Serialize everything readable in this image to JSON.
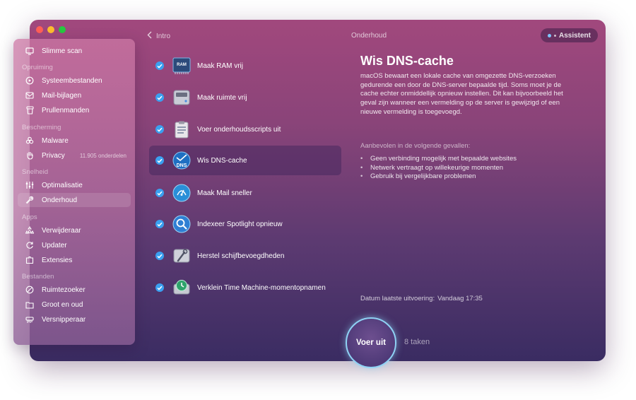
{
  "topbar": {
    "back_label": "Intro",
    "title": "Onderhoud",
    "assistant_label": "Assistent"
  },
  "sidebar": {
    "items": [
      {
        "label": "Slimme scan",
        "icon": "monitor-icon"
      },
      {
        "section": "Opruiming"
      },
      {
        "label": "Systeembestanden",
        "icon": "disc-icon"
      },
      {
        "label": "Mail-bijlagen",
        "icon": "envelope-icon"
      },
      {
        "label": "Prullenmanden",
        "icon": "trash-icon"
      },
      {
        "section": "Bescherming"
      },
      {
        "label": "Malware",
        "icon": "biohazard-icon"
      },
      {
        "label": "Privacy",
        "icon": "hand-icon",
        "extra": "11.905 onderdelen"
      },
      {
        "section": "Snelheid"
      },
      {
        "label": "Optimalisatie",
        "icon": "sliders-icon"
      },
      {
        "label": "Onderhoud",
        "icon": "wrench-icon",
        "active": true
      },
      {
        "section": "Apps"
      },
      {
        "label": "Verwijderaar",
        "icon": "apps-icon"
      },
      {
        "label": "Updater",
        "icon": "refresh-icon"
      },
      {
        "label": "Extensies",
        "icon": "extension-icon"
      },
      {
        "section": "Bestanden"
      },
      {
        "label": "Ruimtezoeker",
        "icon": "pie-icon"
      },
      {
        "label": "Groot en oud",
        "icon": "folder-icon"
      },
      {
        "label": "Versnipperaar",
        "icon": "shredder-icon"
      }
    ]
  },
  "tasks": [
    {
      "label": "Maak RAM vrij",
      "icon": "ram-icon",
      "checked": true
    },
    {
      "label": "Maak ruimte vrij",
      "icon": "drive-icon",
      "checked": true
    },
    {
      "label": "Voer onderhoudsscripts uit",
      "icon": "clipboard-icon",
      "checked": true
    },
    {
      "label": "Wis DNS-cache",
      "icon": "dns-icon",
      "checked": true,
      "active": true
    },
    {
      "label": "Maak Mail sneller",
      "icon": "mail-speed-icon",
      "checked": true
    },
    {
      "label": "Indexeer Spotlight opnieuw",
      "icon": "spotlight-icon",
      "checked": true
    },
    {
      "label": "Herstel schijfbevoegdheden",
      "icon": "disk-repair-icon",
      "checked": true
    },
    {
      "label": "Verklein Time Machine-momentopnamen",
      "icon": "time-machine-icon",
      "checked": true
    }
  ],
  "ram_icon_text": "RAM",
  "dns_icon_text": "DNS",
  "detail": {
    "title": "Wis DNS-cache",
    "description": "macOS bewaart een lokale cache van omgezette DNS-verzoeken gedurende een door de DNS-server bepaalde tijd. Soms moet je de cache echter onmiddellijk opnieuw instellen. Dit kan bijvoorbeeld het geval zijn wanneer een vermelding op de server is gewijzigd of een nieuwe vermelding is toegevoegd.",
    "recommended_heading": "Aanbevolen in de volgende gevallen:",
    "recommended": [
      "Geen verbinding mogelijk met bepaalde websites",
      "Netwerk vertraagt op willekeurige momenten",
      "Gebruik bij vergelijkbare problemen"
    ],
    "last_run_label": "Datum laatste uitvoering:",
    "last_run_value": "Vandaag 17:35"
  },
  "run_button": "Voer uit",
  "task_count": "8 taken"
}
